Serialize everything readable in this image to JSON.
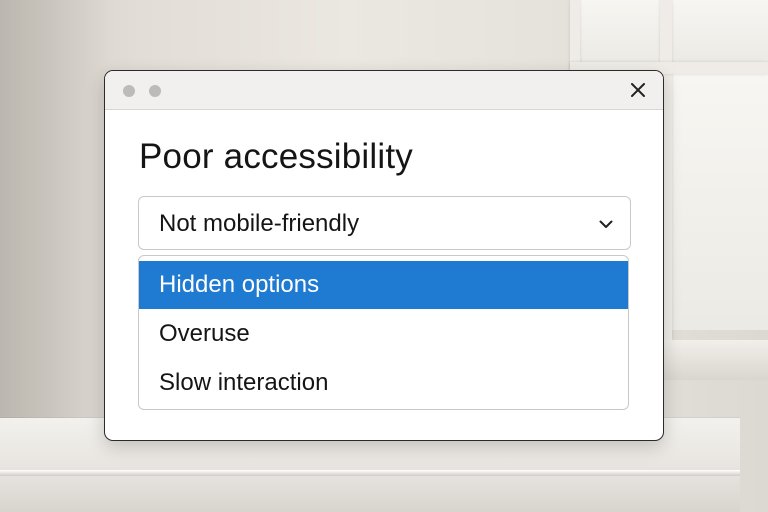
{
  "dialog": {
    "title": "Poor accessibility",
    "close_icon": "close-icon"
  },
  "select": {
    "value": "Not mobile-friendly",
    "icon": "chevron-down-icon"
  },
  "options": [
    {
      "label": "Hidden options",
      "selected": true
    },
    {
      "label": "Overuse",
      "selected": false
    },
    {
      "label": "Slow interaction",
      "selected": false
    }
  ],
  "colors": {
    "selected_option_bg": "#1f7ad1",
    "selected_option_text": "#ffffff"
  }
}
